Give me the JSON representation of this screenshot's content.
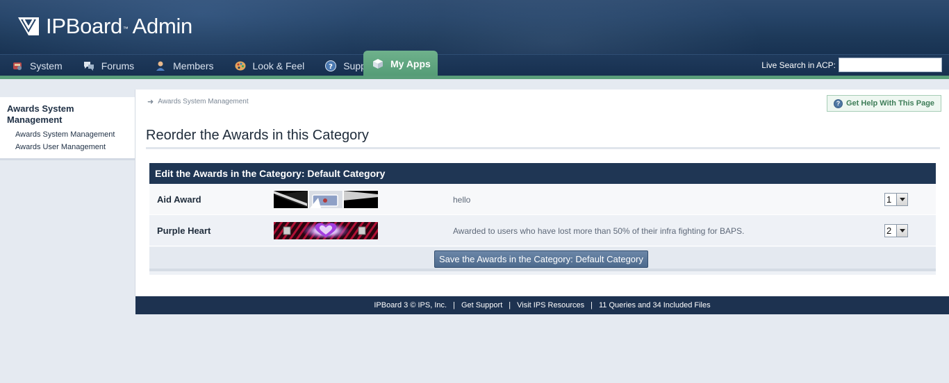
{
  "header": {
    "logo_name": "IPBoard",
    "logo_tm": "™",
    "logo_suffix": "Admin"
  },
  "nav": {
    "tabs": [
      {
        "label": "System",
        "icon": "system-icon"
      },
      {
        "label": "Forums",
        "icon": "forums-icon"
      },
      {
        "label": "Members",
        "icon": "members-icon"
      },
      {
        "label": "Look & Feel",
        "icon": "palette-icon"
      },
      {
        "label": "Support",
        "icon": "help-icon"
      },
      {
        "label": "My Apps",
        "icon": "apps-icon",
        "active": true
      }
    ],
    "live_search_label": "Live Search in ACP:",
    "live_search_value": ""
  },
  "sidebar": {
    "title": "Awards System Management",
    "links": [
      {
        "label": "Awards System Management"
      },
      {
        "label": "Awards User Management"
      }
    ]
  },
  "main": {
    "breadcrumb": "Awards System Management",
    "help_button": "Get Help With This Page",
    "page_title": "Reorder the Awards in this Category",
    "box_title": "Edit the Awards in the Category: Default Category",
    "awards": [
      {
        "name": "Aid Award",
        "description": "hello",
        "order": "1"
      },
      {
        "name": "Purple Heart",
        "description": "Awarded to users who have lost more than 50% of their infra fighting for BAPS.",
        "order": "2"
      }
    ],
    "save_button": "Save the Awards in the Category: Default Category"
  },
  "footer": {
    "copyright": "IPBoard 3 © IPS, Inc.",
    "links": [
      "Get Support",
      "Visit IPS Resources"
    ],
    "stats": "11 Queries and 34 Included Files"
  },
  "colors": {
    "header_dark": "#1d3959",
    "active_tab": "#5fa681",
    "table_header": "#1f3654",
    "footer": "#1d3250"
  }
}
